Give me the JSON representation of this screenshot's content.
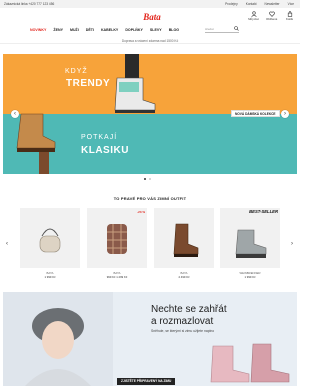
{
  "topbar": {
    "hotline": "Zákaznická linka +420 777 123 456",
    "links": [
      "Prodejny",
      "Kontakt",
      "Newsletter",
      "Více"
    ]
  },
  "header": {
    "logo": "Bata",
    "icons": [
      {
        "name": "account-icon",
        "label": "Můj účet"
      },
      {
        "name": "wishlist-icon",
        "label": "Oblíbené"
      },
      {
        "name": "cart-icon",
        "label": "Košík"
      }
    ],
    "nav": [
      "NOVINKY",
      "ŽENY",
      "MUŽI",
      "DĚTI",
      "KABELKY",
      "DOPLŇKY",
      "SLEVY",
      "BLOG"
    ],
    "search_placeholder": "Hledat"
  },
  "promo_text": "Doprava a vrácení zdarma nad 1500 Kč",
  "hero": {
    "line1": "KDYŽ",
    "line2": "TRENDY",
    "line3": "POTKAJÍ",
    "line4": "KLASIKU",
    "cta": "NOVÁ DÁMSKÁ KOLEKCE",
    "colors": {
      "top": "#f7a33a",
      "bottom": "#4fb9b5"
    }
  },
  "section_title": "TO PRAVÉ PRO VÁS ZIMNÍ OUTFIT",
  "products": [
    {
      "category": "BATA",
      "price": "1 999 Kč",
      "badge": ""
    },
    {
      "category": "BATA",
      "price": "999 Kč  1 299 Kč",
      "badge": "-23 %"
    },
    {
      "category": "BATA",
      "price": "2 499 Kč",
      "badge": ""
    },
    {
      "category": "WEINBRENNER",
      "price": "1 999 Kč",
      "badge": "BEST-SELLER"
    }
  ],
  "banner": {
    "headline_1": "Nechte se zahřát",
    "headline_2": "a rozmazlovat",
    "sub": "Sněhule, se kterými si zimu užijete naplno",
    "cta": "ZJISTĚTE PŘIPRAVENÝ NA ZIMU"
  },
  "accent_color": "#e2231a"
}
